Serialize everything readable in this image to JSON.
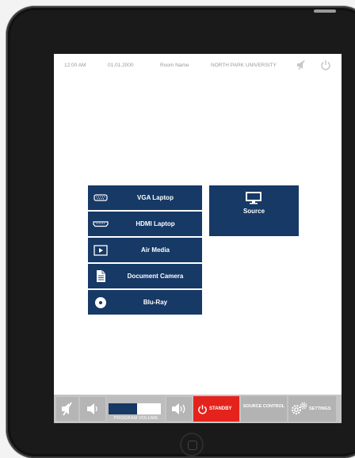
{
  "status": {
    "time": "12:00 AM",
    "date": "01.01.2000",
    "room": "Room Name",
    "org": "NORTH PARK UNIVERSITY"
  },
  "sources": [
    {
      "label": "VGA Laptop",
      "icon": "vga-port-icon"
    },
    {
      "label": "HDMI Laptop",
      "icon": "hdmi-port-icon"
    },
    {
      "label": "Air Media",
      "icon": "play-icon"
    },
    {
      "label": "Document Camera",
      "icon": "document-icon"
    },
    {
      "label": "Blu-Ray",
      "icon": "disc-icon"
    }
  ],
  "display": {
    "label": "Source",
    "icon": "monitor-icon"
  },
  "bottom": {
    "volume_label": "PROGRAM VOLUME",
    "volume_level": 0.55,
    "standby_label": "STANDBY",
    "source_control_label": "SOURCE CONTROL",
    "settings_label": "SETTINGS"
  },
  "colors": {
    "accent": "#163966",
    "standby": "#e5231d",
    "bar": "#c4c4c4"
  }
}
